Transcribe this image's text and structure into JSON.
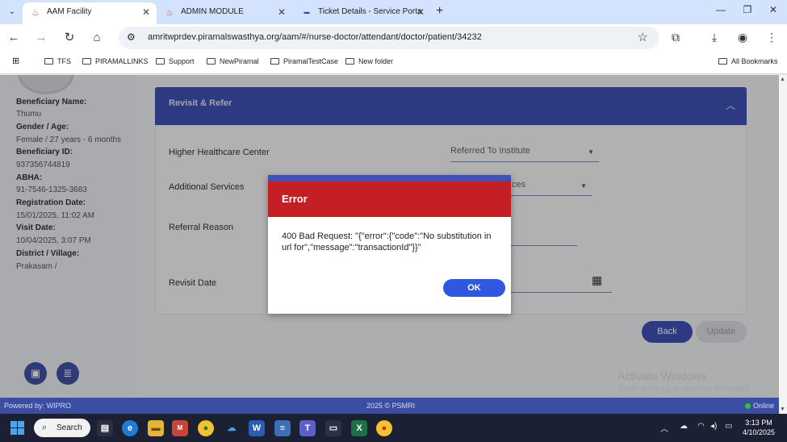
{
  "browser": {
    "tabs": [
      {
        "title": "AAM Facility",
        "active": true
      },
      {
        "title": "ADMIN MODULE",
        "active": false
      },
      {
        "title": "Ticket Details - Service Porta",
        "active": false
      }
    ],
    "url": "amritwprdev.piramalswasthya.org/aam/#/nurse-doctor/attendant/doctor/patient/34232",
    "bookmarks": [
      "TFS",
      "PIRAMALLINKS",
      "Support",
      "NewPiramal",
      "PiramalTestCase",
      "New folder"
    ],
    "all_bookmarks": "All Bookmarks"
  },
  "beneficiary": {
    "name_label": "Beneficiary Name:",
    "name": "Thumu",
    "gender_age_label": "Gender / Age:",
    "gender_age": "Female / 27 years - 6 months",
    "id_label": "Beneficiary ID:",
    "id": "937356744819",
    "abha_label": "ABHA:",
    "abha": "91-7546-1325-3683",
    "registration_label": "Registration Date:",
    "registration": "15/01/2025, 11:02 AM",
    "visit_label": "Visit Date:",
    "visit": "10/04/2025, 3:07 PM",
    "district_label": "District / Village:",
    "district": "Prakasam /"
  },
  "panel": {
    "title": "Revisit & Refer",
    "fields": {
      "higher_center": "Higher Healthcare Center",
      "higher_center_placeholder": "Referred To Institute",
      "additional_services": "Additional Services",
      "additional_services_partial": "ces",
      "referral_reason": "Referral Reason",
      "revisit_date": "Revisit Date"
    },
    "back": "Back",
    "update": "Update"
  },
  "dialog": {
    "title": "Error",
    "message": "400 Bad Request: \"{\"error\":{\"code\":\"No substitution in url for\",\"message\":\"transactionId\"}}\"",
    "ok": "OK"
  },
  "footer": {
    "powered": "Powered by: WIPRO",
    "copyright": "2025 © PSMRI",
    "status": "Online"
  },
  "watermark": {
    "line1": "Activate Windows",
    "line2": "Go to Settings to activate Windows."
  },
  "taskbar": {
    "search": "Search",
    "time": "3:13 PM",
    "date": "4/10/2025"
  },
  "colors": {
    "primary": "#3f51b5",
    "error_header": "#c41f24",
    "ok_button": "#2f58e0"
  }
}
